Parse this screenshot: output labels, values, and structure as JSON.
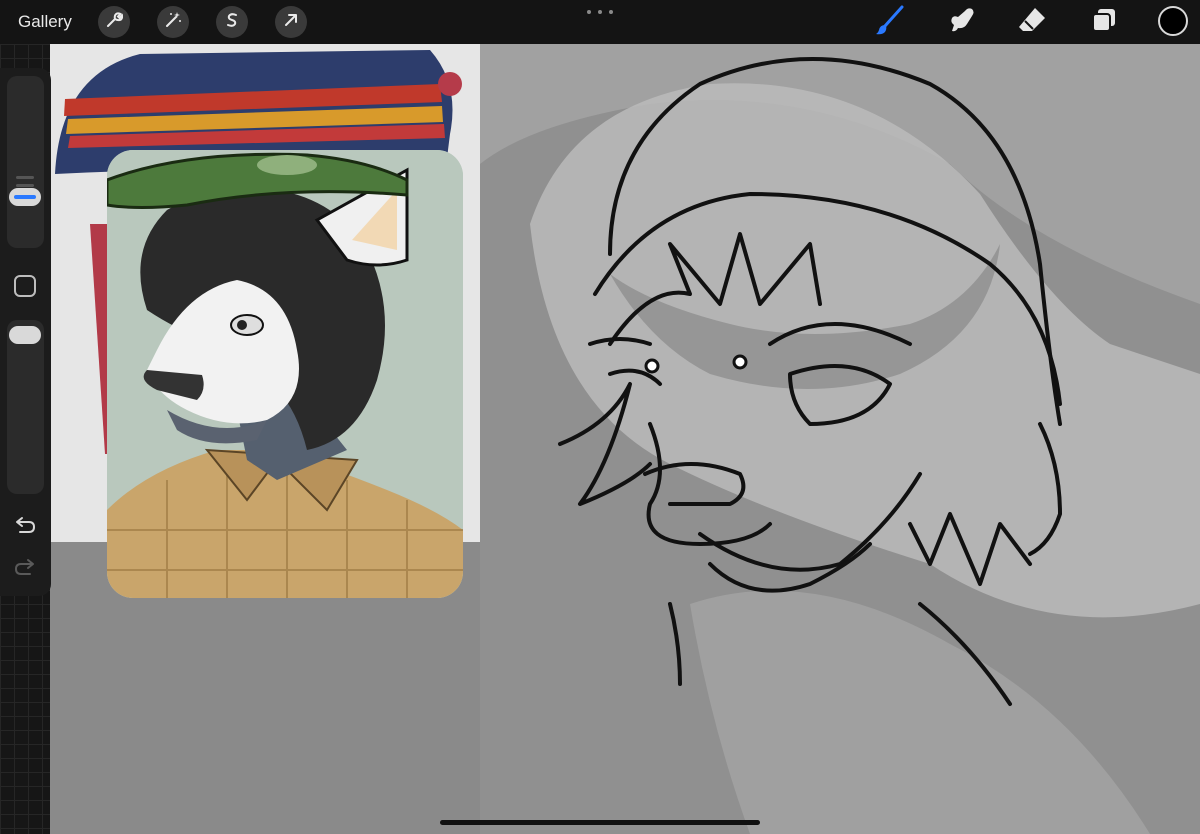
{
  "app": {
    "gallery_label": "Gallery"
  },
  "topbar": {
    "left_tools": [
      {
        "name": "actions",
        "icon": "wrench-icon"
      },
      {
        "name": "adjustments",
        "icon": "magic-wand-icon"
      },
      {
        "name": "selection",
        "icon": "selection-s-icon"
      },
      {
        "name": "transform",
        "icon": "arrow-cursor-icon"
      }
    ],
    "right_tools": [
      {
        "name": "brush",
        "icon": "brush-icon",
        "active": true
      },
      {
        "name": "smudge",
        "icon": "smudge-finger-icon"
      },
      {
        "name": "eraser",
        "icon": "eraser-icon"
      },
      {
        "name": "layers",
        "icon": "layers-icon"
      }
    ],
    "current_color": "#000000",
    "accent_color": "#2a79ff"
  },
  "sidebar": {
    "brush_size_level": 0.7,
    "brush_opacity_level": 1.0,
    "icons": [
      "modify-square-icon",
      "undo-icon",
      "redo-icon"
    ]
  }
}
